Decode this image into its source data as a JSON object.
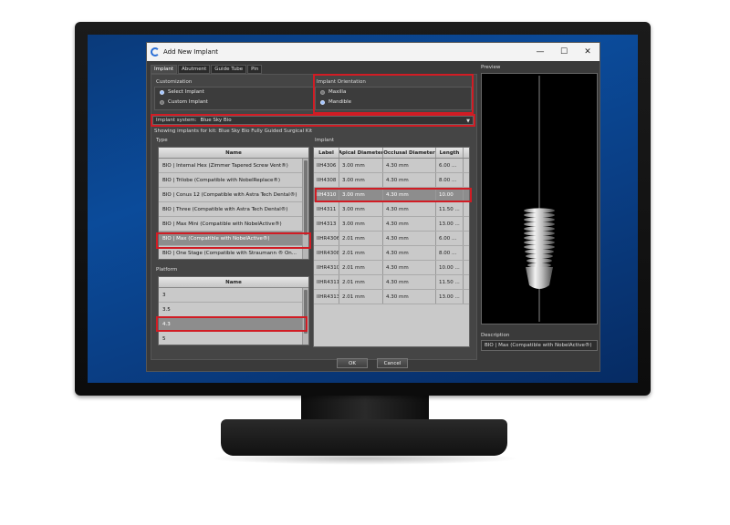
{
  "dialog": {
    "title": "Add New Implant"
  },
  "tabs": [
    "Implant",
    "Abutment",
    "Guide Tube",
    "Pin"
  ],
  "customization": {
    "label": "Customization",
    "options": [
      {
        "label": "Select Implant",
        "selected": true
      },
      {
        "label": "Custom Implant",
        "selected": false
      }
    ]
  },
  "orientation": {
    "label": "Implant Orientation",
    "options": [
      {
        "label": "Maxilla",
        "selected": false
      },
      {
        "label": "Mandible",
        "selected": true
      }
    ]
  },
  "system": {
    "label": "Implant system:",
    "value": "Blue Sky Bio"
  },
  "info_text": "Showing implants for kit:  Blue Sky Bio Fully Guided Surgical Kit",
  "type_list": {
    "label": "Type",
    "header": "Name",
    "items": [
      "BIO | Internal Hex (Zimmer Tapered Screw Vent®)",
      "BIO | Trilobe (Compatible with NobelReplace®)",
      "BIO | Conus 12 (Compatible with Astra Tech Dental®)",
      "BIO | Three (Compatible with Astra Tech Dental®)",
      "BIO | Max Mini (Compatible with NobelActive®)",
      "BIO | Max (Compatible with NobelActive®)",
      "BIO | One Stage (Compatible with Straumann ® On..."
    ],
    "selected_index": 5
  },
  "platform_list": {
    "label": "Platform",
    "header": "Name",
    "items": [
      "3",
      "3.5",
      "4.3",
      "5"
    ],
    "selected_index": 2
  },
  "implant_table": {
    "label": "Implant",
    "columns": [
      "Label",
      "Apical Diameter",
      "Occlusal Diameter",
      "Length"
    ],
    "rows": [
      [
        "IIH4306",
        "3.00 mm",
        "4.30 mm",
        "6.00 ..."
      ],
      [
        "IIH4308",
        "3.00 mm",
        "4.30 mm",
        "8.00 ..."
      ],
      [
        "IIH4310",
        "3.00 mm",
        "4.30 mm",
        "10.00"
      ],
      [
        "IIH4311",
        "3.00 mm",
        "4.30 mm",
        "11.50 ..."
      ],
      [
        "IIH4313",
        "3.00 mm",
        "4.30 mm",
        "13.00 ..."
      ],
      [
        "IIHR4306",
        "2.01 mm",
        "4.30 mm",
        "6.00 ..."
      ],
      [
        "IIHR4308",
        "2.01 mm",
        "4.30 mm",
        "8.00 ..."
      ],
      [
        "IIHR4310",
        "2.01 mm",
        "4.30 mm",
        "10.00 ..."
      ],
      [
        "IIHR4311",
        "2.01 mm",
        "4.30 mm",
        "11.50 ..."
      ],
      [
        "IIHR4313",
        "2.01 mm",
        "4.30 mm",
        "13.00 ..."
      ]
    ],
    "selected_index": 2
  },
  "preview": {
    "label": "Preview"
  },
  "description": {
    "label": "Description",
    "value": "BIO | Max (Compatible with NobelActive®)"
  },
  "buttons": {
    "ok": "OK",
    "cancel": "Cancel"
  },
  "window_controls": {
    "minimize": "—",
    "maximize": "☐",
    "close": "✕"
  },
  "colors": {
    "highlight": "#d11c24",
    "desktop": "#0b4b9a"
  }
}
